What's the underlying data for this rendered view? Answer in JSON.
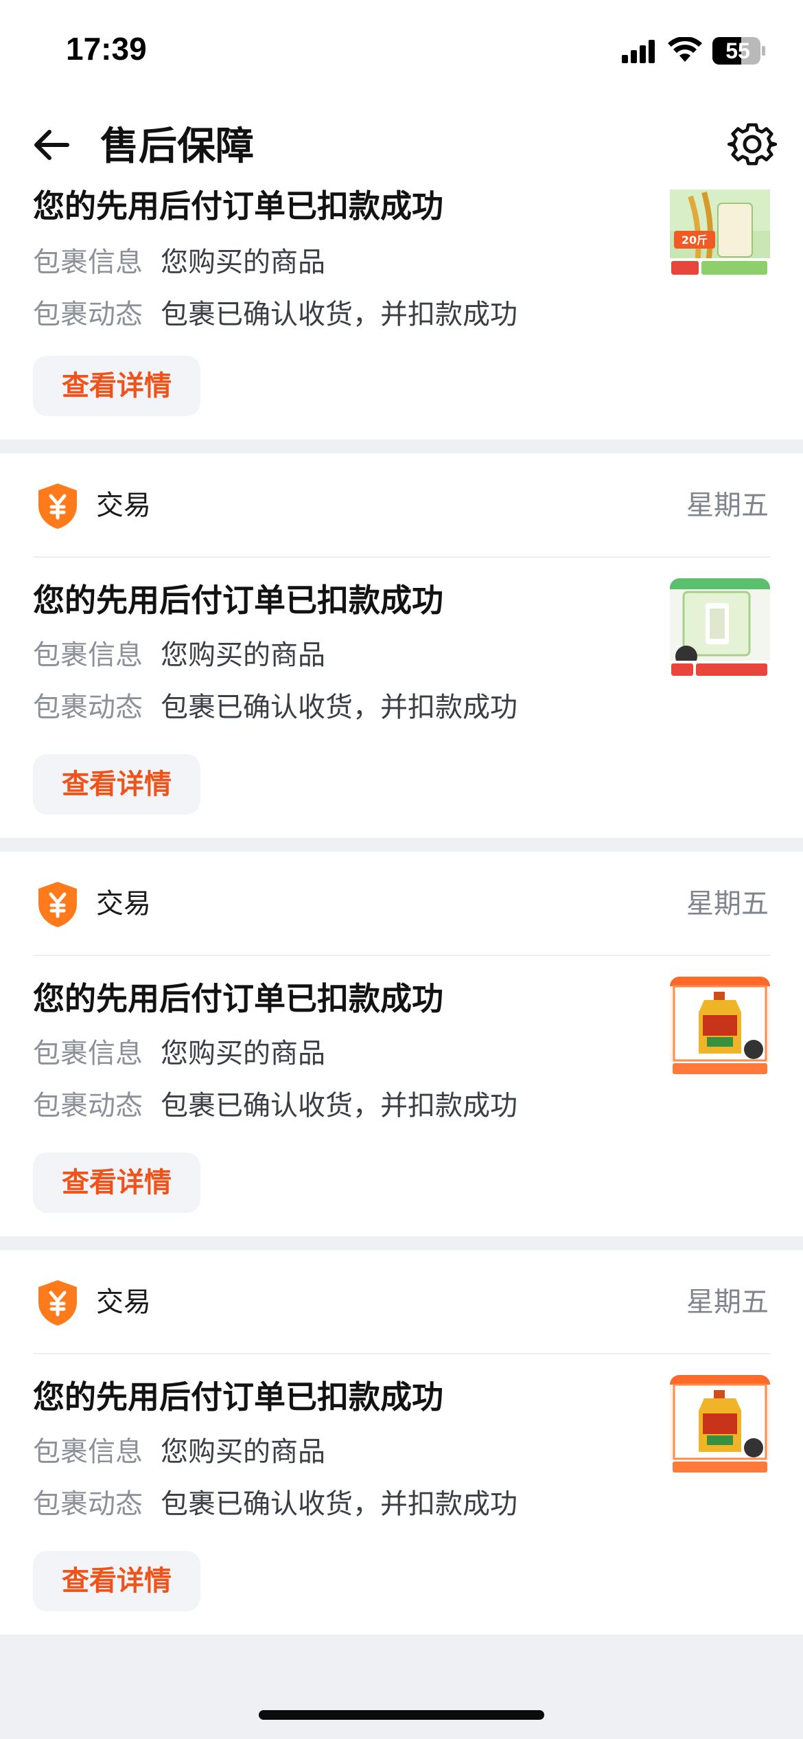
{
  "status_bar": {
    "time": "17:39",
    "battery": "55"
  },
  "header": {
    "title": "售后保障"
  },
  "first_card": {
    "title": "您的先用后付订单已扣款成功",
    "package_info_label": "包裹信息",
    "package_info_value": "您购买的商品",
    "package_status_label": "包裹动态",
    "package_status_value": "包裹已确认收货，并扣款成功",
    "button_label": "查看详情",
    "thumb_text": "20斤"
  },
  "cards": [
    {
      "source": "交易",
      "date": "星期五",
      "title": "您的先用后付订单已扣款成功",
      "package_info_label": "包裹信息",
      "package_info_value": "您购买的商品",
      "package_status_label": "包裹动态",
      "package_status_value": "包裹已确认收货，并扣款成功",
      "button_label": "查看详情"
    },
    {
      "source": "交易",
      "date": "星期五",
      "title": "您的先用后付订单已扣款成功",
      "package_info_label": "包裹信息",
      "package_info_value": "您购买的商品",
      "package_status_label": "包裹动态",
      "package_status_value": "包裹已确认收货，并扣款成功",
      "button_label": "查看详情"
    },
    {
      "source": "交易",
      "date": "星期五",
      "title": "您的先用后付订单已扣款成功",
      "package_info_label": "包裹信息",
      "package_info_value": "您购买的商品",
      "package_status_label": "包裹动态",
      "package_status_value": "包裹已确认收货，并扣款成功",
      "button_label": "查看详情"
    }
  ],
  "icons": {
    "back": "arrow-left-icon",
    "settings": "gear-icon",
    "source": "yuan-shield-icon",
    "thumbs": [
      "rice-bag-product-image",
      "rice-bag-product-image",
      "oil-bottle-product-image",
      "oil-bottle-product-image"
    ]
  },
  "colors": {
    "accent": "#f0531a",
    "source_icon": "#ff7a1a",
    "page_bg": "#eef0f4"
  }
}
